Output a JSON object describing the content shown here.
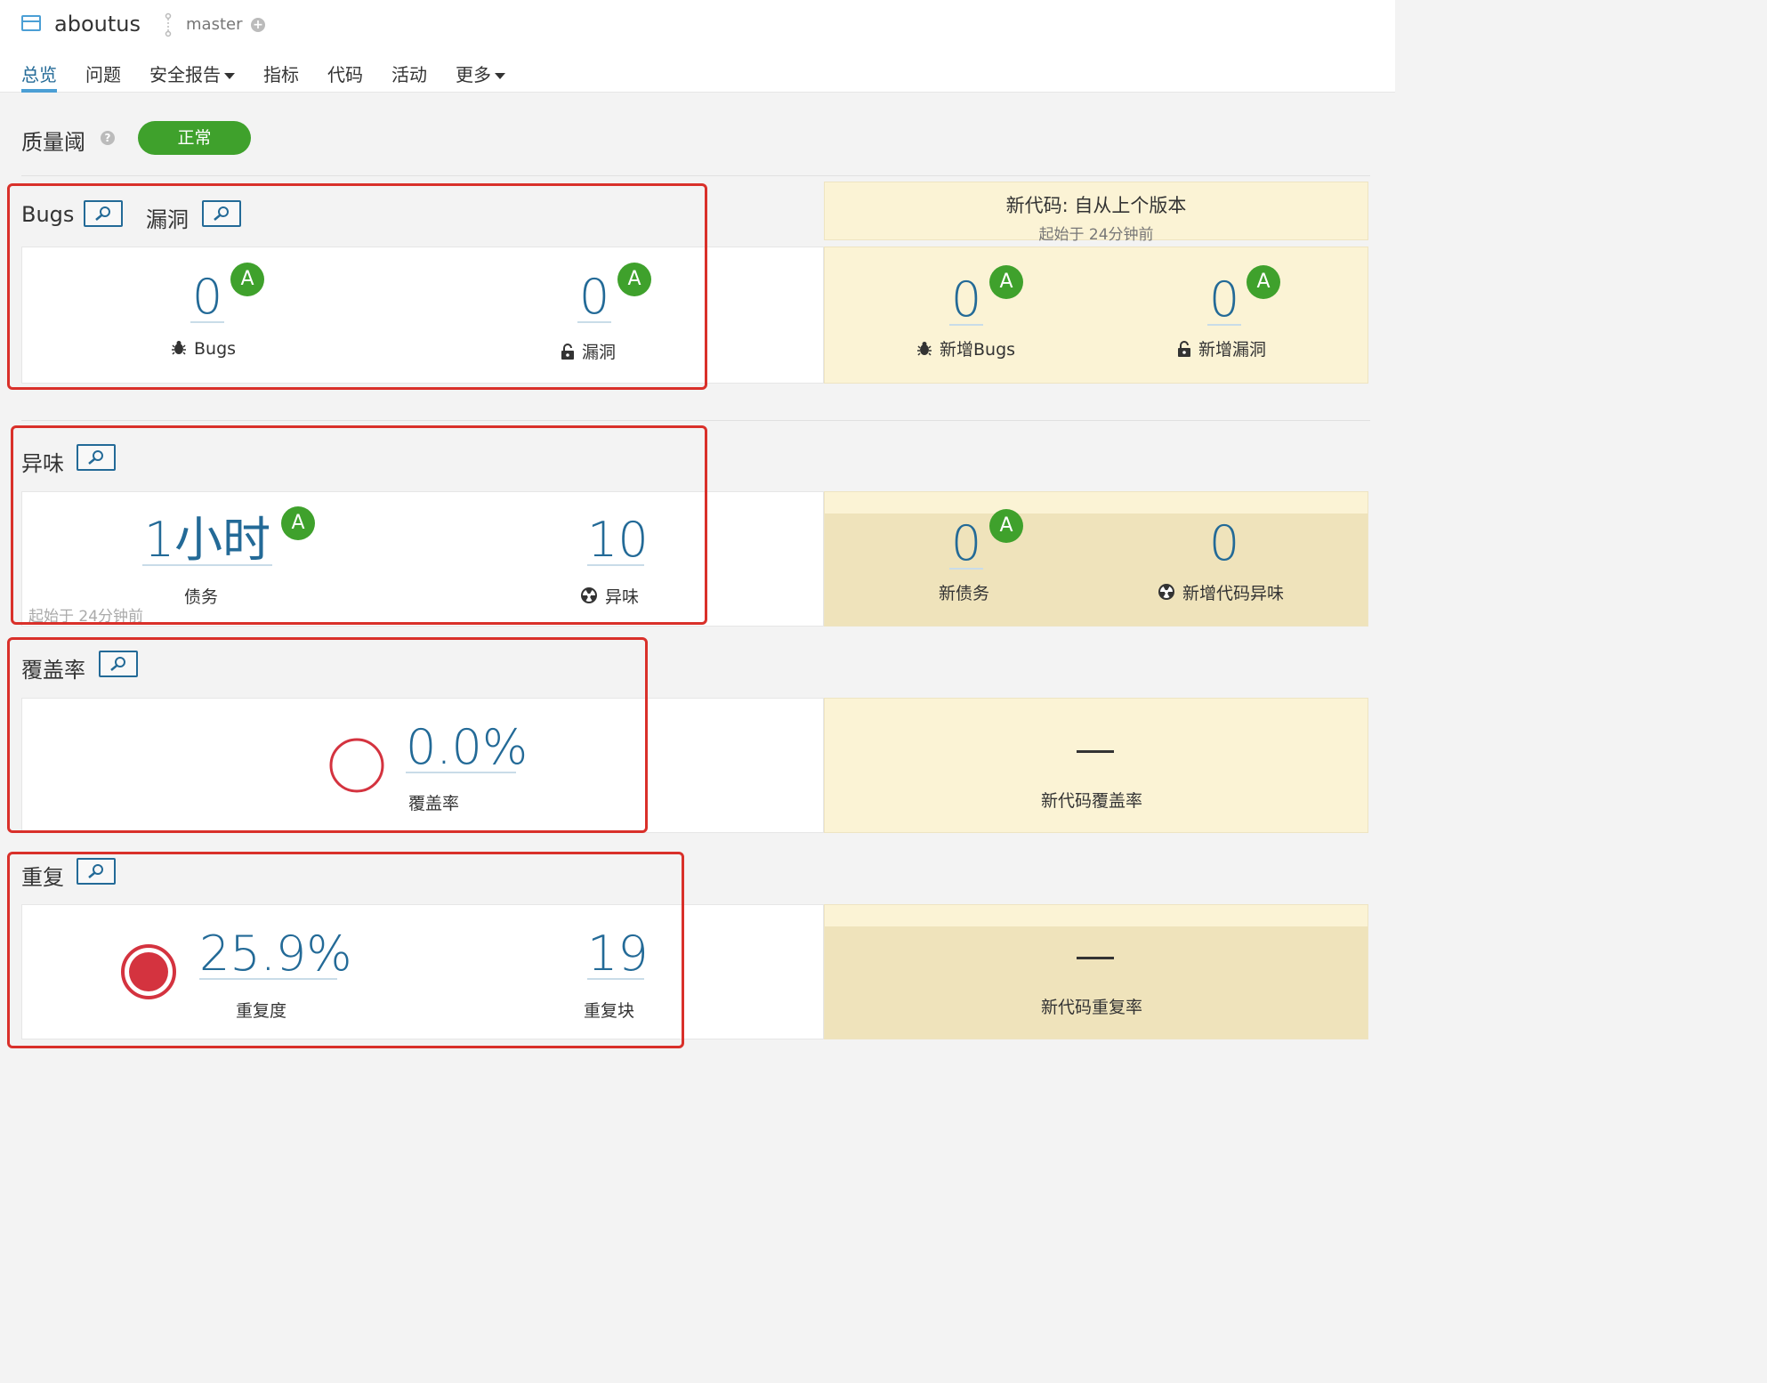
{
  "project": {
    "name": "aboutus",
    "branch": "master"
  },
  "nav": [
    "总览",
    "问题",
    "安全报告",
    "指标",
    "代码",
    "活动",
    "更多"
  ],
  "quality_gate": {
    "label": "质量阈",
    "status": "正常"
  },
  "new_code": {
    "title": "新代码: 自从上个版本",
    "since": "起始于 24分钟前"
  },
  "reliability": {
    "title_bugs": "Bugs",
    "title_vulns": "漏洞",
    "bugs": {
      "value": "0",
      "rating": "A",
      "label": "Bugs"
    },
    "vulns": {
      "value": "0",
      "rating": "A",
      "label": "漏洞"
    },
    "new_bugs": {
      "value": "0",
      "rating": "A",
      "label": "新增Bugs"
    },
    "new_vulns": {
      "value": "0",
      "rating": "A",
      "label": "新增漏洞"
    }
  },
  "maintainability": {
    "title": "异味",
    "debt": {
      "value": "1小时",
      "rating": "A",
      "label": "债务"
    },
    "smells": {
      "value": "10",
      "label": "异味"
    },
    "since": "起始于 24分钟前",
    "new_debt": {
      "value": "0",
      "rating": "A",
      "label": "新债务"
    },
    "new_smells": {
      "value": "0",
      "label": "新增代码异味"
    }
  },
  "coverage": {
    "title": "覆盖率",
    "value": "0.0%",
    "label": "覆盖率",
    "new_value": "—",
    "new_label": "新代码覆盖率"
  },
  "duplications": {
    "title": "重复",
    "density": {
      "value": "25.9%",
      "label": "重复度"
    },
    "blocks": {
      "value": "19",
      "label": "重复块"
    },
    "new_value": "—",
    "new_label": "新代码重复率"
  },
  "colors": {
    "accent": "#236a97",
    "passed": "#3fa12c",
    "error": "#d4333f",
    "highlight": "#d9302a",
    "new_code_bg": "#fbf3d5"
  }
}
